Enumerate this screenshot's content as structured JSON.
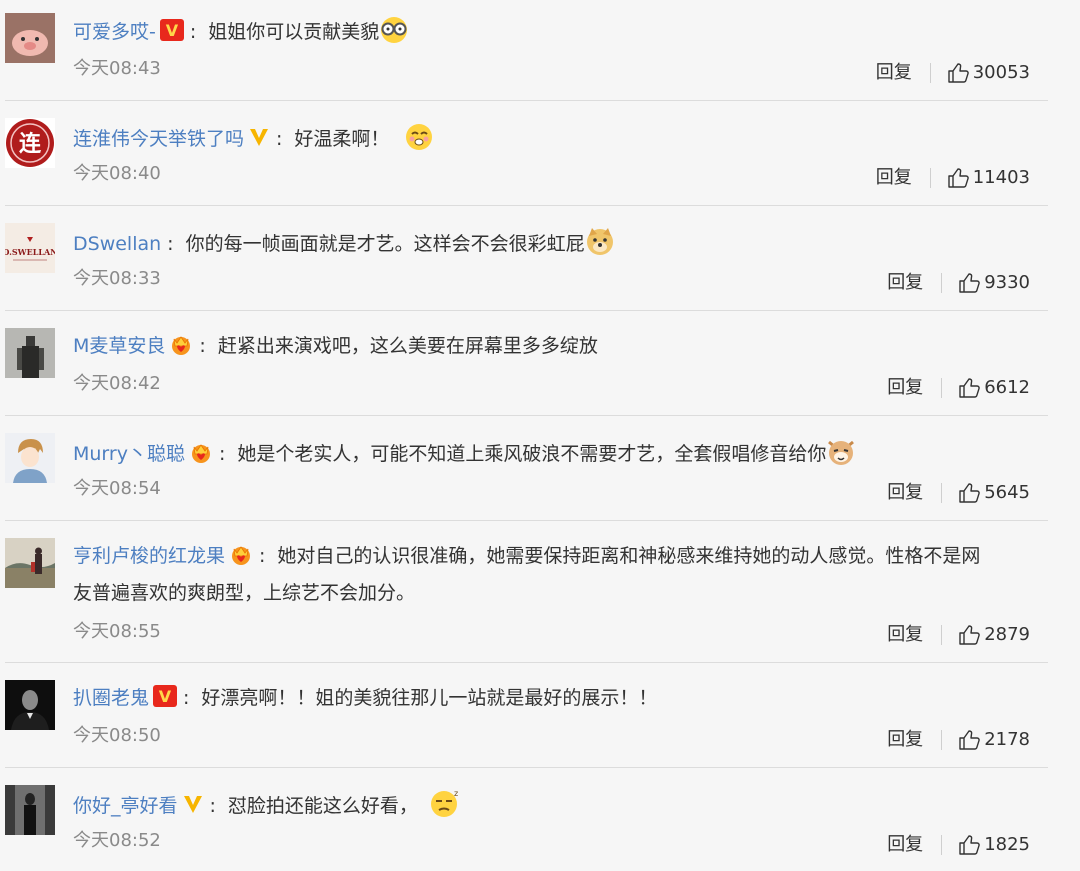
{
  "colors": {
    "username": "#4d7fc1",
    "text": "#333333",
    "time": "#8a8a8a",
    "badge_orange": "#f7941d",
    "divider": "#dcdcdc"
  },
  "comments": [
    {
      "user": "可爱多哎-",
      "badge": "vip-v-box",
      "text": "姐姐你可以贡献美貌",
      "emoji": "glasses-face-emoji",
      "time": "今天08:43",
      "reply": "回复",
      "likes": "30053"
    },
    {
      "user": "连淮伟今天举铁了吗",
      "badge": "verified-v",
      "text": "好温柔啊！",
      "emoji": "blushing-face-emoji",
      "time": "今天08:40",
      "reply": "回复",
      "likes": "11403"
    },
    {
      "user": "DSwellan",
      "badge": "",
      "text": "你的每一帧画面就是才艺。这样会不会很彩虹屁",
      "emoji": "doge-emoji",
      "time": "今天08:33",
      "reply": "回复",
      "likes": "9330"
    },
    {
      "user": "M麦草安良",
      "badge": "crown-fan",
      "text": "赶紧出来演戏吧，这么美要在屏幕里多多绽放",
      "emoji": "",
      "time": "今天08:42",
      "reply": "回复",
      "likes": "6612"
    },
    {
      "user": "Murry丶聪聪",
      "badge": "crown-fan",
      "text": "她是个老实人，可能不知道上乘风破浪不需要才艺，全套假唱修音给你",
      "emoji": "cat-emoji",
      "time": "今天08:54",
      "reply": "回复",
      "likes": "5645"
    },
    {
      "user": "亨利卢梭的红龙果",
      "badge": "crown-fan",
      "text_line1": "她对自己的认识很准确，她需要保持距离和神秘感来维持她的动人感觉。性格不是网",
      "text_line2": "友普遍喜欢的爽朗型，上综艺不会加分。",
      "time": "今天08:55",
      "reply": "回复",
      "likes": "2879"
    },
    {
      "user": "扒圈老鬼",
      "badge": "vip-v-box",
      "text": "好漂亮啊！！姐的美貌往那儿一站就是最好的展示！！",
      "emoji": "",
      "time": "今天08:50",
      "reply": "回复",
      "likes": "2178"
    },
    {
      "user": "你好_亭好看",
      "badge": "verified-v",
      "text": "怼脸拍还能这么好看，",
      "emoji": "sleepy-face-emoji",
      "time": "今天08:52",
      "reply": "回复",
      "likes": "1825"
    }
  ]
}
